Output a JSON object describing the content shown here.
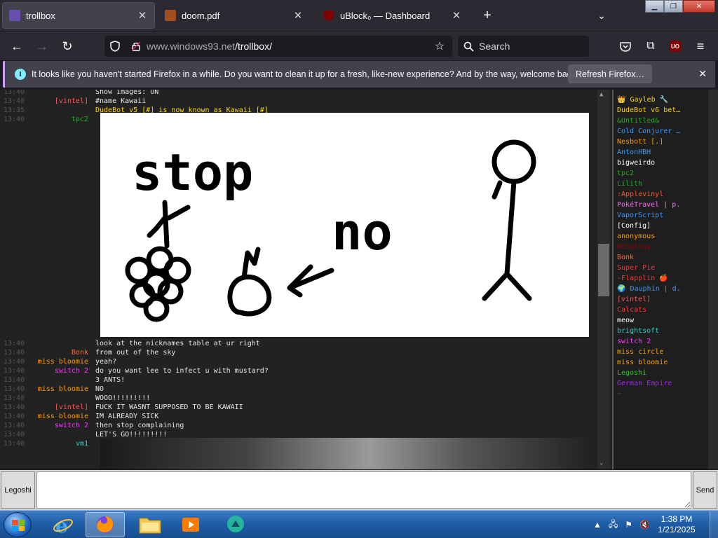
{
  "browser": {
    "tabs": [
      {
        "title": "trollbox",
        "active": true,
        "favicon": "trollbox-icon"
      },
      {
        "title": "doom.pdf",
        "active": false,
        "favicon": "pdf-icon"
      },
      {
        "title": "uBlock₀ — Dashboard",
        "active": false,
        "favicon": "ublock-icon"
      }
    ],
    "new_tab_label": "+",
    "url_host": "www.windows93.net",
    "url_path": "/trollbox/",
    "search_placeholder": "Search",
    "ublock_badge": "UO"
  },
  "notification": {
    "message": "It looks like you haven't started Firefox in a while. Do you want to clean it up for a fresh, like-new experience? And by the way, welcome back!",
    "button": "Refresh Firefox…"
  },
  "chat": {
    "top_messages": [
      {
        "time": "13:40",
        "nick": "",
        "nick_color": "#888",
        "text": "Show images: ON"
      },
      {
        "time": "13:40",
        "nick": "[vintel]",
        "nick_color": "#ff5555",
        "text": "#name Kawaii"
      },
      {
        "time": "13:35",
        "nick": "",
        "nick_color": "#888",
        "text": "DudeBot v5 [#] is now known as Kawaii [#]",
        "text_color": "#ffd700"
      },
      {
        "time": "13:40",
        "nick": "tpc2",
        "nick_color": "#22aa22",
        "text": ""
      }
    ],
    "image_text": [
      "stop",
      "no"
    ],
    "bottom_messages": [
      {
        "time": "13:40",
        "nick": "",
        "nick_color": "#888",
        "text": "look at the nicknames table at ur right"
      },
      {
        "time": "13:40",
        "nick": "Bonk",
        "nick_color": "#ff6633",
        "text": "from out of the sky"
      },
      {
        "time": "13:40",
        "nick": "miss bloomie",
        "nick_color": "#ff9900",
        "text": "yeah?"
      },
      {
        "time": "13:40",
        "nick": "switch 2",
        "nick_color": "#ff33ff",
        "text": "do you want lee to infect u with mustard?"
      },
      {
        "time": "13:40",
        "nick": "",
        "nick_color": "#888",
        "text": "3 ANTS!"
      },
      {
        "time": "13:40",
        "nick": "miss bloomie",
        "nick_color": "#ff9900",
        "text": "NO"
      },
      {
        "time": "13:40",
        "nick": "",
        "nick_color": "#888",
        "text": "WOOO!!!!!!!!!"
      },
      {
        "time": "13:40",
        "nick": "[vintel]",
        "nick_color": "#ff5555",
        "text": "FUCK IT WASNT SUPPOSED TO BE KAWAII"
      },
      {
        "time": "13:40",
        "nick": "miss bloomie",
        "nick_color": "#ff9900",
        "text": "IM ALREADY SICK"
      },
      {
        "time": "13:40",
        "nick": "switch 2",
        "nick_color": "#ff33ff",
        "text": "then stop complaining"
      },
      {
        "time": "13:40",
        "nick": "",
        "nick_color": "#888",
        "text": "LET'S GO!!!!!!!!!"
      },
      {
        "time": "13:40",
        "nick": "vm1",
        "nick_color": "#33cccc",
        "text": ""
      }
    ],
    "users": [
      {
        "name": "👑 Gayleb 🔧",
        "color": "#ffd700"
      },
      {
        "name": "DudeBot v6 bet…",
        "color": "#ffd700"
      },
      {
        "name": "&Untitled&",
        "color": "#22aa22"
      },
      {
        "name": "Cold Conjurer …",
        "color": "#3399ff"
      },
      {
        "name": "Nesbott [.]",
        "color": "#ff9900"
      },
      {
        "name": "AntonHBH",
        "color": "#3399ff"
      },
      {
        "name": "bigweirdo",
        "color": "#ffffff"
      },
      {
        "name": "tpc2",
        "color": "#22aa22"
      },
      {
        "name": "Lilith",
        "color": "#22aa22"
      },
      {
        "name": ":Applevinyl",
        "color": "#ff5533"
      },
      {
        "name": "PokéTravel | p.",
        "color": "#ff66ff"
      },
      {
        "name": "VaporScript",
        "color": "#3399ff"
      },
      {
        "name": "[Config]",
        "color": "#ffffff"
      },
      {
        "name": "anonymous",
        "color": "#ff9900"
      },
      {
        "name": "Nebulous",
        "color": "#990000"
      },
      {
        "name": "Bonk",
        "color": "#ff6633"
      },
      {
        "name": "Super Pie",
        "color": "#ff3333"
      },
      {
        "name": "-Flapplin 🍎",
        "color": "#ff3333"
      },
      {
        "name": "🌍 Dauphin | d.",
        "color": "#3399ff"
      },
      {
        "name": "[vintel]",
        "color": "#ff5555"
      },
      {
        "name": "Calcats",
        "color": "#ff3333"
      },
      {
        "name": "meow",
        "color": "#ffffff"
      },
      {
        "name": "brightsoft",
        "color": "#33cccc"
      },
      {
        "name": "switch 2",
        "color": "#ff33ff"
      },
      {
        "name": "miss circle",
        "color": "#ff9900"
      },
      {
        "name": "miss bloomie",
        "color": "#ff9900"
      },
      {
        "name": "Legoshi",
        "color": "#22cc22"
      },
      {
        "name": "German Empire",
        "color": "#aa22ff"
      },
      {
        "name": "~",
        "color": "#555555"
      }
    ],
    "nick_button": "Legoshi",
    "input_value": "",
    "send_button": "Send"
  },
  "taskbar": {
    "apps": [
      "internet-explorer-icon",
      "firefox-icon",
      "file-explorer-icon",
      "media-player-icon",
      "messenger-icon"
    ],
    "clock_time": "1:38 PM",
    "clock_date": "1/21/2025"
  }
}
